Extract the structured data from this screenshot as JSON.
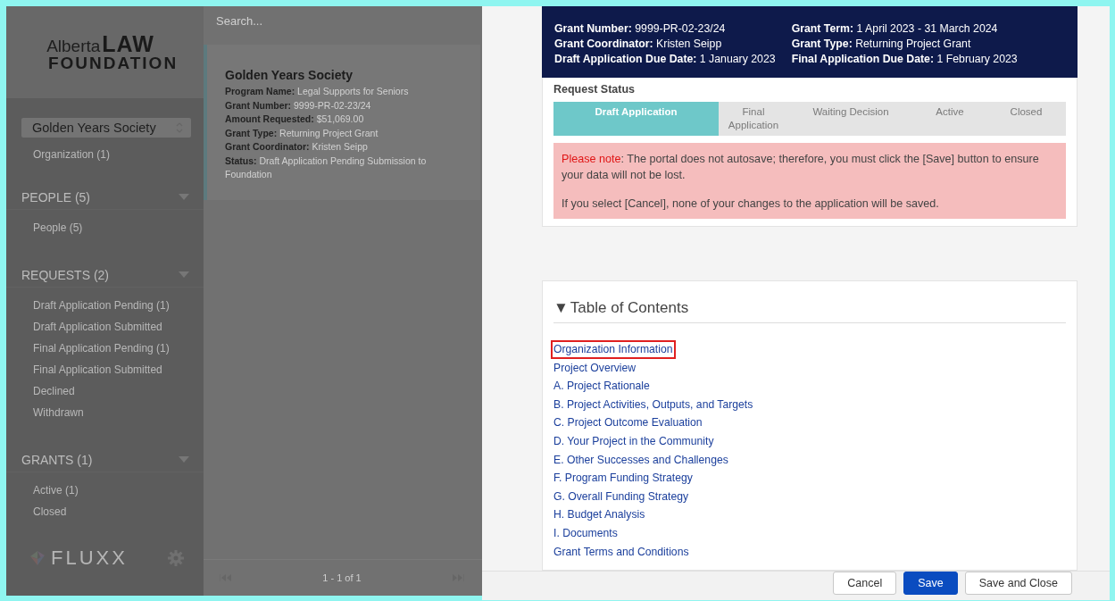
{
  "sidebar": {
    "logo": {
      "word_1": "Alberta",
      "word_2": "LAW",
      "word_3": "FOUNDATION"
    },
    "org_select": {
      "value": "Golden Years Society"
    },
    "org_link": "Organization (1)",
    "sections": [
      {
        "title": "PEOPLE (5)",
        "expanded": true,
        "items": [
          "People (5)"
        ]
      },
      {
        "title": "REQUESTS (2)",
        "expanded": true,
        "items": [
          "Draft Application Pending (1)",
          "Draft Application Submitted",
          "Final Application Pending (1)",
          "Final Application Submitted",
          "Declined",
          "Withdrawn"
        ]
      },
      {
        "title": "GRANTS (1)",
        "expanded": true,
        "items": [
          "Active (1)",
          "Closed"
        ]
      }
    ],
    "brand": "FLUXX"
  },
  "list": {
    "search": {
      "placeholder": "Search..."
    },
    "cards": [
      {
        "title": "Golden Years Society",
        "selected": true,
        "fields": [
          {
            "label": "Program Name:",
            "value": "Legal Supports for Seniors"
          },
          {
            "label": "Grant Number:",
            "value": "9999-PR-02-23/24"
          },
          {
            "label": "Amount Requested:",
            "value": "$51,069.00"
          },
          {
            "label": "Grant Type:",
            "value": "Returning Project Grant"
          },
          {
            "label": "Grant Coordinator:",
            "value": "Kristen Seipp"
          },
          {
            "label": "Status:",
            "value": "Draft Application Pending Submission to Foundation"
          }
        ]
      }
    ],
    "pagination": {
      "range": "1 - 1 of 1"
    }
  },
  "detail": {
    "header": {
      "columns": [
        [
          {
            "label": "Grant Number:",
            "value": "9999-PR-02-23/24"
          },
          {
            "label": "Grant Coordinator:",
            "value": "Kristen Seipp"
          },
          {
            "label": "Draft Application Due Date:",
            "value": "1 January 2023"
          }
        ],
        [
          {
            "label": "Grant Term:",
            "value": "1 April 2023 - 31 March 2024"
          },
          {
            "label": "Grant Type:",
            "value": "Returning Project Grant"
          },
          {
            "label": "Final Application Due Date:",
            "value": "1 February 2023"
          }
        ]
      ]
    },
    "request_status": {
      "title": "Request Status",
      "steps": [
        {
          "label": "Draft Application",
          "selected": true
        },
        {
          "label": "Final Application",
          "selected": false
        },
        {
          "label": "Waiting Decision",
          "selected": false
        },
        {
          "label": "Active",
          "selected": false
        },
        {
          "label": "Closed",
          "selected": false
        }
      ]
    },
    "notice": [
      {
        "lead": "Please note",
        "text": ": The portal does not autosave;  therefore, you must click the [Save] button to ensure your data will not be lost."
      },
      {
        "text": "If you select [Cancel], none of your changes to the application will be saved."
      }
    ],
    "toc": {
      "toggle": "▼",
      "title": "Table of Contents",
      "links": [
        {
          "label": "Organization Information",
          "highlighted": true
        },
        {
          "label": "Project Overview",
          "highlighted": false
        },
        {
          "label": "A. Project Rationale",
          "highlighted": false
        },
        {
          "label": "B. Project Activities, Outputs, and Targets",
          "highlighted": false
        },
        {
          "label": "C. Project Outcome Evaluation",
          "highlighted": false
        },
        {
          "label": "D. Your Project in the Community",
          "highlighted": false
        },
        {
          "label": "E. Other Successes and Challenges",
          "highlighted": false
        },
        {
          "label": "F. Program Funding Strategy",
          "highlighted": false
        },
        {
          "label": "G. Overall Funding Strategy",
          "highlighted": false
        },
        {
          "label": "H. Budget Analysis",
          "highlighted": false
        },
        {
          "label": "I. Documents",
          "highlighted": false
        },
        {
          "label": "Grant Terms and Conditions",
          "highlighted": false
        }
      ]
    },
    "buttons": [
      {
        "label": "Cancel",
        "kind": "default"
      },
      {
        "label": "Save",
        "kind": "primary"
      },
      {
        "label": "Save and Close",
        "kind": "default"
      }
    ]
  }
}
